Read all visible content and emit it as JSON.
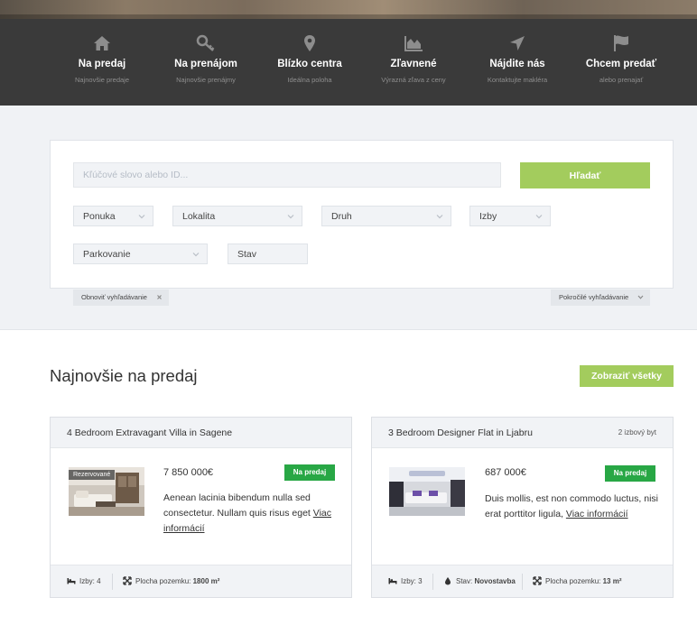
{
  "nav": {
    "items": [
      {
        "title": "Na predaj",
        "subtitle": "Najnovšie predaje",
        "icon": "home-icon"
      },
      {
        "title": "Na prenájom",
        "subtitle": "Najnovšie prenájmy",
        "icon": "key-icon"
      },
      {
        "title": "Blízko centra",
        "subtitle": "Ideálna poloha",
        "icon": "map-pin-icon"
      },
      {
        "title": "Zľavnené",
        "subtitle": "Výrazná zľava z ceny",
        "icon": "area-chart-icon"
      },
      {
        "title": "Nájdite nás",
        "subtitle": "Kontaktujte makléra",
        "icon": "location-arrow-icon"
      },
      {
        "title": "Chcem predať",
        "subtitle": "alebo prenajať",
        "icon": "flag-icon"
      }
    ]
  },
  "search": {
    "keyword_placeholder": "Kľúčové slovo alebo ID...",
    "keyword_value": "",
    "button_label": "Hľadať",
    "filters": {
      "offer": "Ponuka",
      "location": "Lokalita",
      "type": "Druh",
      "rooms": "Izby",
      "parking": "Parkovanie",
      "status": "Stav"
    },
    "reset_label": "Obnoviť vyhľadávanie",
    "advanced_label": "Pokročilé vyhľadávanie"
  },
  "listings": {
    "title": "Najnovšie na predaj",
    "show_all_label": "Zobraziť všetky",
    "cards": [
      {
        "title": "4 Bedroom Extravagant Villa in Sagene",
        "type": "",
        "price": "7 850 000€",
        "badge": "Na predaj",
        "reserved": "Rezervované",
        "description": "Aenean lacinia bibendum nulla sed consectetur. Nullam quis risus eget",
        "more_link": "Viac informácií",
        "rooms_label": "Izby:",
        "rooms_value": "4",
        "area_label": "Plocha pozemku:",
        "area_value": "1800 m²"
      },
      {
        "title": "3 Bedroom Designer Flat in Ljabru",
        "type": "2 izbový byt",
        "price": "687 000€",
        "badge": "Na predaj",
        "description": "Duis mollis, est non commodo luctus, nisi erat porttitor ligula,",
        "more_link": "Viac informácií",
        "rooms_label": "Izby:",
        "rooms_value": "3",
        "status_label": "Stav:",
        "status_value": "Novostavba",
        "area_label": "Plocha pozemku:",
        "area_value": "13 m²"
      }
    ]
  },
  "colors": {
    "nav_bg": "#3a3a3a",
    "accent_green": "#a3cc5d",
    "badge_green": "#28a745",
    "band_bg": "#f0f2f5"
  }
}
